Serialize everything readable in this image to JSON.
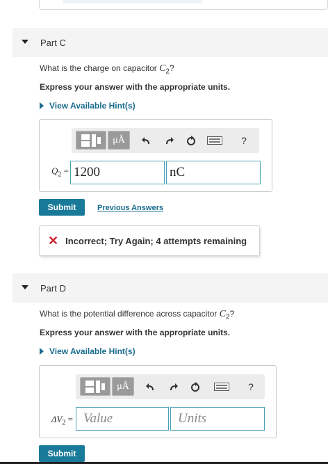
{
  "partC": {
    "title": "Part C",
    "question_prefix": "What is the charge on capacitor ",
    "question_var": "C",
    "question_sub": "2",
    "question_suffix": "?",
    "instruction": "Express your answer with the appropriate units.",
    "hint_label": "View Available Hint(s)",
    "toolbar": {
      "units_label": "μÅ",
      "undo_icon": "undo-icon",
      "redo_icon": "redo-icon",
      "reset_icon": "reset-icon",
      "keyboard_icon": "keyboard-icon",
      "help_label": "?"
    },
    "answer_label_var": "Q",
    "answer_label_sub": "2",
    "answer_label_eq": " =",
    "value": "1200",
    "units": "nC",
    "submit_label": "Submit",
    "previous_answers_label": "Previous Answers",
    "feedback": {
      "icon": "✕",
      "message": "Incorrect; Try Again; 4 attempts remaining"
    }
  },
  "partD": {
    "title": "Part D",
    "question_prefix": "What is the potential difference across capacitor ",
    "question_var": "C",
    "question_sub": "2",
    "question_suffix": "?",
    "instruction": "Express your answer with the appropriate units.",
    "hint_label": "View Available Hint(s)",
    "toolbar": {
      "units_label": "μÅ",
      "help_label": "?"
    },
    "answer_label_var": "ΔV",
    "answer_label_sub": "2",
    "answer_label_eq": " =",
    "value_placeholder": "Value",
    "units_placeholder": "Units",
    "submit_label": "Submit"
  },
  "colors": {
    "accent": "#1a7a9a",
    "link": "#1a6c8f",
    "error": "#d1242f",
    "field_border": "#4aa0b5"
  }
}
